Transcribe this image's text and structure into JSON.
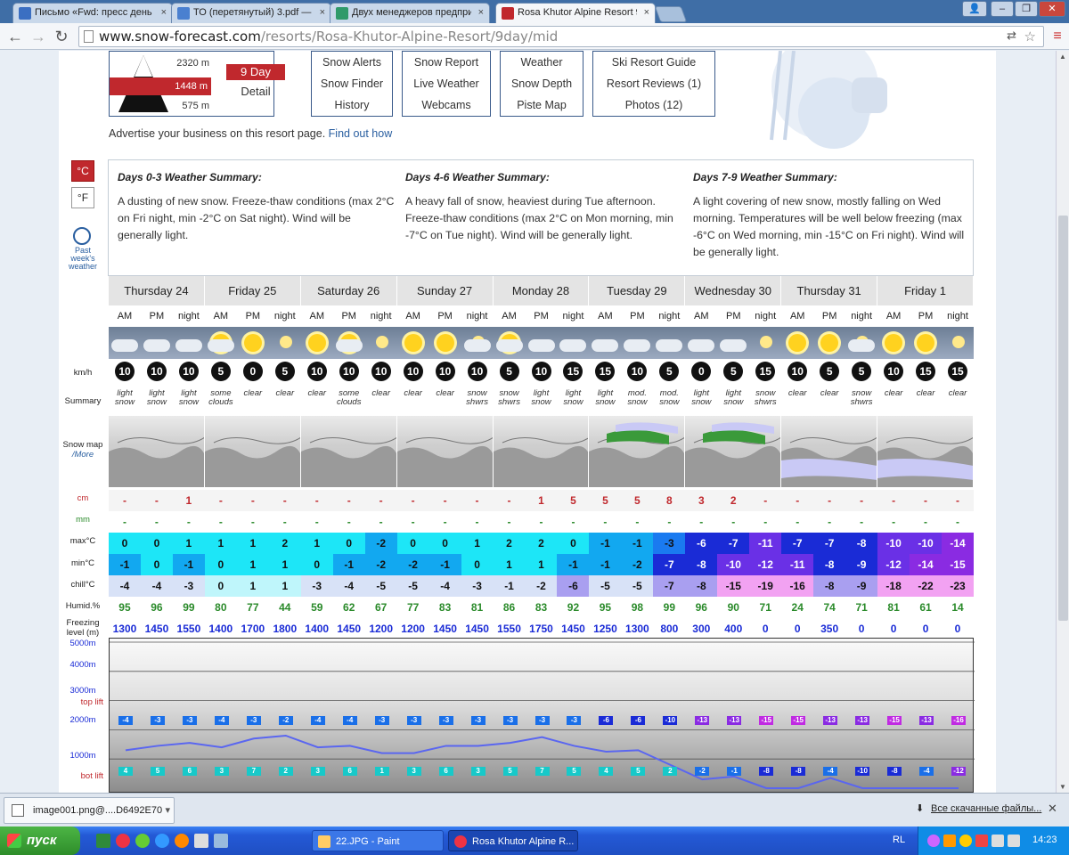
{
  "browser": {
    "tabs": [
      {
        "label": "Письмо «Fwd: пресс день я",
        "color": "#3b6fc2"
      },
      {
        "label": "ТО (перетянутый) 3.pdf — ",
        "color": "#4a80d0"
      },
      {
        "label": "Двух менеджеров предпри",
        "color": "#2f9a6a"
      },
      {
        "label": "Rosa Khutor Alpine Resort 9 ",
        "color": "#c0282d"
      }
    ],
    "tab_close": "×",
    "url_domain": "www.snow-forecast.com",
    "url_path": "/resorts/Rosa-Khutor-Alpine-Resort/9day/mid",
    "win_min": "–",
    "win_max": "❐",
    "win_close": "✕",
    "user_icon": "👤"
  },
  "resort": {
    "alt_top": "2320 m",
    "alt_mid": "1448 m",
    "alt_bot": "575 m",
    "forecast_days": "9 Day",
    "detail": "Detail",
    "advert": "Advertise your business on this resort page.",
    "advert_link": "Find out how"
  },
  "nav": [
    [
      "Snow Alerts",
      "Snow Finder",
      "History"
    ],
    [
      "Snow Report",
      "Live Weather",
      "Webcams"
    ],
    [
      "Weather",
      "Snow Depth",
      "Piste Map"
    ],
    [
      "Ski Resort Guide",
      "Resort Reviews (1)",
      "Photos (12)"
    ]
  ],
  "units": {
    "c": "°C",
    "f": "°F"
  },
  "past_week": [
    "Past",
    "week's",
    "weather"
  ],
  "summaries": [
    {
      "title": "Days 0-3 Weather Summary:",
      "text": "A dusting of new snow. Freeze-thaw conditions (max 2°C on Fri night, min -2°C on Sat night). Wind will be generally light."
    },
    {
      "title": "Days 4-6 Weather Summary:",
      "text": "A heavy fall of snow, heaviest during Tue afternoon. Freeze-thaw conditions (max 2°C on Mon morning, min -7°C on Tue night). Wind will be generally light."
    },
    {
      "title": "Days 7-9 Weather Summary:",
      "text": "A light covering of new snow, mostly falling on Wed morning. Temperatures will be well below freezing (max -6°C on Wed morning, min -15°C on Fri night). Wind will be generally light."
    }
  ],
  "row_labels": {
    "wind": "km/h",
    "summary": "Summary",
    "snowmap": "Snow map",
    "more": "/More",
    "snow": "cm",
    "rain": "mm",
    "max": "max°C",
    "min": "min°C",
    "chill": "chill°C",
    "humid": "Humid.%",
    "freezing": "Freezing level (m)",
    "alt5000": "5000m",
    "alt4000": "4000m",
    "alt3000": "3000m",
    "alt2000": "2000m",
    "alt1000": "1000m",
    "toplift": "top lift",
    "botlift": "bot lift"
  },
  "days": [
    "Thursday 24",
    "Friday 25",
    "Saturday 26",
    "Sunday 27",
    "Monday 28",
    "Tuesday 29",
    "Wednesday 30",
    "Thursday 31",
    "Friday 1"
  ],
  "periods": [
    "AM",
    "PM",
    "night"
  ],
  "weather_icons": [
    "cloud-icon",
    "cloud-icon",
    "cloud-night-icon",
    "sun-cloud-icon",
    "sun-icon",
    "moon-icon",
    "sun-icon",
    "sun-cloud-icon",
    "moon-icon",
    "sun-icon",
    "sun-icon",
    "moon-cloud-icon",
    "sun-cloud-icon",
    "cloud-icon",
    "cloud-night-icon",
    "cloud-icon",
    "cloud-icon",
    "cloud-night-icon",
    "cloud-icon",
    "cloud-icon",
    "moon-icon",
    "sun-icon",
    "sun-icon",
    "moon-cloud-icon",
    "sun-icon",
    "sun-icon",
    "moon-icon"
  ],
  "wind": [
    "10",
    "10",
    "10",
    "5",
    "0",
    "5",
    "10",
    "10",
    "10",
    "10",
    "10",
    "10",
    "5",
    "10",
    "15",
    "15",
    "10",
    "5",
    "0",
    "5",
    "15",
    "10",
    "5",
    "5",
    "10",
    "15",
    "15"
  ],
  "summary": [
    "light snow",
    "light snow",
    "light snow",
    "some clouds",
    "clear",
    "clear",
    "clear",
    "some clouds",
    "clear",
    "clear",
    "clear",
    "snow shwrs",
    "snow shwrs",
    "light snow",
    "light snow",
    "light snow",
    "mod. snow",
    "mod. snow",
    "light snow",
    "light snow",
    "snow shwrs",
    "clear",
    "clear",
    "snow shwrs",
    "clear",
    "clear",
    "clear"
  ],
  "snow_cm": [
    "-",
    "-",
    "1",
    "-",
    "-",
    "-",
    "-",
    "-",
    "-",
    "-",
    "-",
    "-",
    "-",
    "1",
    "5",
    "5",
    "5",
    "8",
    "3",
    "2",
    "-",
    "-",
    "-",
    "-",
    "-",
    "-",
    "-"
  ],
  "rain_mm": [
    "-",
    "-",
    "-",
    "-",
    "-",
    "-",
    "-",
    "-",
    "-",
    "-",
    "-",
    "-",
    "-",
    "-",
    "-",
    "-",
    "-",
    "-",
    "-",
    "-",
    "-",
    "-",
    "-",
    "-",
    "-",
    "-",
    "-"
  ],
  "max_c": [
    "0",
    "0",
    "1",
    "1",
    "1",
    "2",
    "1",
    "0",
    "-2",
    "0",
    "0",
    "1",
    "2",
    "2",
    "0",
    "-1",
    "-1",
    "-3",
    "-6",
    "-7",
    "-11",
    "-7",
    "-7",
    "-8",
    "-10",
    "-10",
    "-14"
  ],
  "min_c": [
    "-1",
    "0",
    "-1",
    "0",
    "1",
    "1",
    "0",
    "-1",
    "-2",
    "-2",
    "-1",
    "0",
    "1",
    "1",
    "-1",
    "-1",
    "-2",
    "-7",
    "-8",
    "-10",
    "-12",
    "-11",
    "-8",
    "-9",
    "-12",
    "-14",
    "-15"
  ],
  "chill_c": [
    "-4",
    "-4",
    "-3",
    "0",
    "1",
    "1",
    "-3",
    "-4",
    "-5",
    "-5",
    "-4",
    "-3",
    "-1",
    "-2",
    "-6",
    "-5",
    "-5",
    "-7",
    "-8",
    "-15",
    "-19",
    "-16",
    "-8",
    "-9",
    "-18",
    "-22",
    "-23"
  ],
  "humid": [
    "95",
    "96",
    "99",
    "80",
    "77",
    "44",
    "59",
    "62",
    "67",
    "77",
    "83",
    "81",
    "86",
    "83",
    "92",
    "95",
    "98",
    "99",
    "96",
    "90",
    "71",
    "24",
    "74",
    "71",
    "81",
    "61",
    "14"
  ],
  "freezing": [
    "1300",
    "1450",
    "1550",
    "1400",
    "1700",
    "1800",
    "1400",
    "1450",
    "1200",
    "1200",
    "1450",
    "1450",
    "1550",
    "1750",
    "1450",
    "1250",
    "1300",
    "800",
    "300",
    "400",
    "0",
    "0",
    "350",
    "0",
    "0",
    "0",
    "0"
  ],
  "top_lift": [
    "-4",
    "-3",
    "-3",
    "-4",
    "-3",
    "-2",
    "-4",
    "-4",
    "-3",
    "-3",
    "-3",
    "-3",
    "-3",
    "-3",
    "-3",
    "-6",
    "-6",
    "-10",
    "-13",
    "-13",
    "-15",
    "-15",
    "-13",
    "-13",
    "-15",
    "-13",
    "-16"
  ],
  "bot_lift": [
    "4",
    "5",
    "6",
    "3",
    "7",
    "2",
    "3",
    "6",
    "1",
    "3",
    "6",
    "3",
    "5",
    "7",
    "5",
    "4",
    "5",
    "2",
    "-2",
    "-1",
    "-8",
    "-8",
    "-4",
    "-10",
    "-8",
    "-4",
    "-12"
  ],
  "downloads": {
    "file": "image001.png@....D6492E70",
    "all": "Все скачанные файлы..."
  },
  "taskbar": {
    "start": "пуск",
    "tasks": [
      "22.JPG - Paint",
      "Rosa Khutor Alpine R..."
    ],
    "lang": "RL",
    "clock": "14:23"
  },
  "colors": {
    "brand_red": "#c0282d",
    "link_blue": "#2a5fa0",
    "cyan": "#1de6f7",
    "blue": "#1a2bd6",
    "purple": "#8a2be2"
  }
}
